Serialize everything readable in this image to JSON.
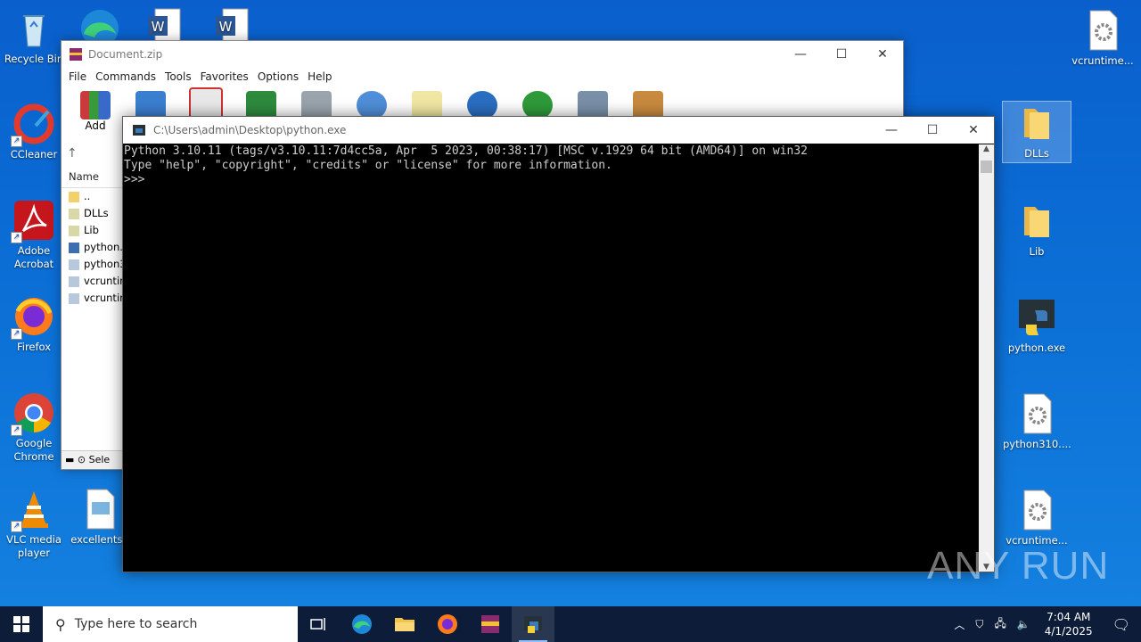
{
  "desktop": {
    "left_icons": [
      {
        "label": "Recycle Bin"
      },
      {
        "label": "CCleaner"
      },
      {
        "label": "Adobe Acrobat"
      },
      {
        "label": "Firefox"
      },
      {
        "label": "Google Chrome"
      },
      {
        "label": "VLC media player"
      },
      {
        "label": "excellentsp"
      }
    ],
    "right_icons": [
      {
        "label": "vcruntime..."
      },
      {
        "label": "DLLs"
      },
      {
        "label": "Lib"
      },
      {
        "label": "python.exe"
      },
      {
        "label": "python310...."
      },
      {
        "label": "vcruntime..."
      }
    ]
  },
  "winrar": {
    "title": "Document.zip",
    "menu": [
      "File",
      "Commands",
      "Tools",
      "Favorites",
      "Options",
      "Help"
    ],
    "toolbar_first_label": "Add",
    "list_header": "Name",
    "files": [
      "..",
      "DLLs",
      "Lib",
      "python.e",
      "python3",
      "vcruntim",
      "vcruntim"
    ],
    "status": "Sele"
  },
  "console": {
    "title": "C:\\Users\\admin\\Desktop\\python.exe",
    "lines": [
      "Python 3.10.11 (tags/v3.10.11:7d4cc5a, Apr  5 2023, 00:38:17) [MSC v.1929 64 bit (AMD64)] on win32",
      "Type \"help\", \"copyright\", \"credits\" or \"license\" for more information.",
      ">>>"
    ]
  },
  "taskbar": {
    "search_placeholder": "Type here to search",
    "time": "7:04 AM",
    "date": "4/1/2025"
  },
  "watermark": "ANY RUN"
}
